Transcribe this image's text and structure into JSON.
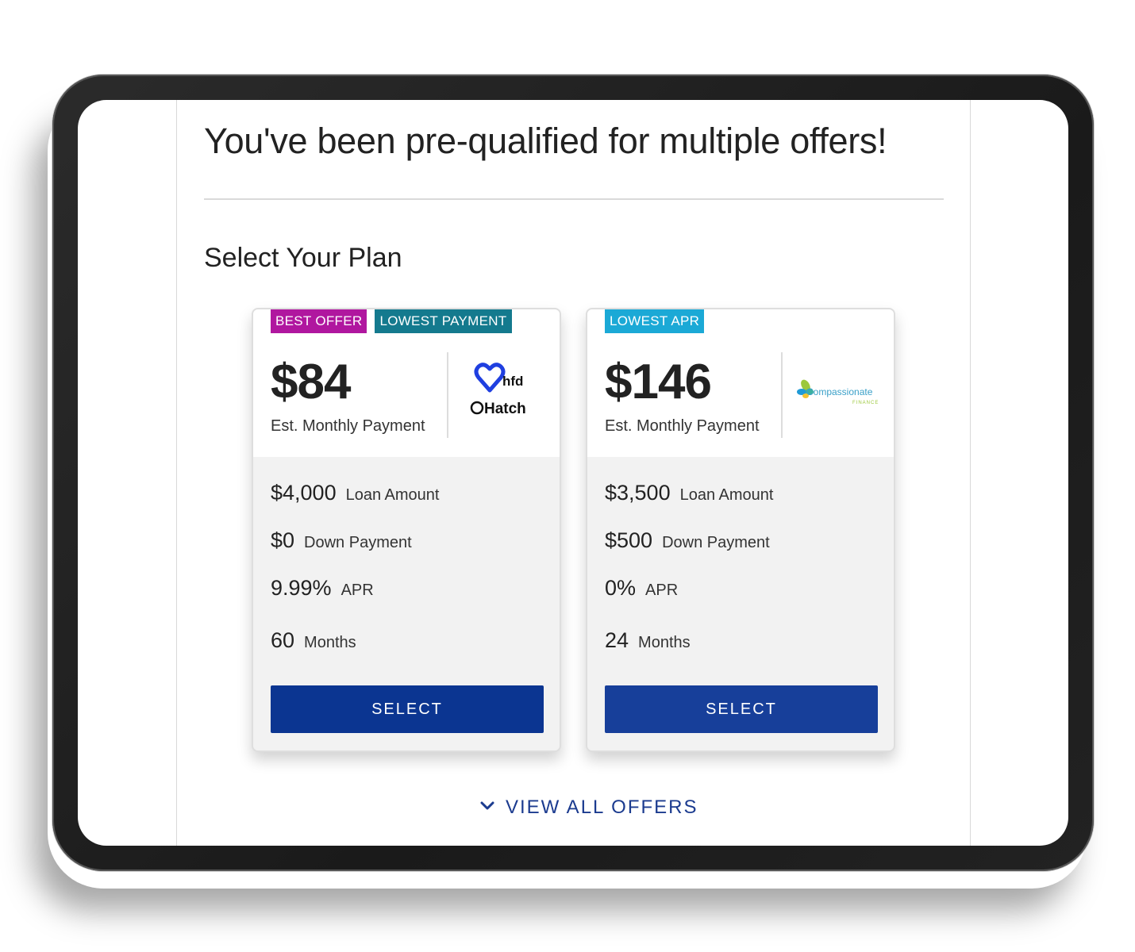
{
  "page": {
    "headline": "You've been pre-qualified for multiple offers!",
    "section_title": "Select Your Plan"
  },
  "offers": [
    {
      "tags": [
        {
          "label": "BEST OFFER",
          "color": "#b0179f"
        },
        {
          "label": "LOWEST PAYMENT",
          "color": "#147a8e"
        }
      ],
      "monthly_payment": "$84",
      "monthly_label": "Est. Monthly Payment",
      "lender_logo": {
        "icon": "hfd-hatch-logo",
        "text_primary": "hfd",
        "text_secondary": "Hatch"
      },
      "loan_amount": "$4,000",
      "loan_amount_label": "Loan Amount",
      "down_payment": "$0",
      "down_payment_label": "Down Payment",
      "apr": "9.99%",
      "apr_label": "APR",
      "term": "60",
      "term_label": "Months",
      "select_label": "SELECT"
    },
    {
      "tags": [
        {
          "label": "LOWEST APR",
          "color": "#1ba9d6"
        }
      ],
      "monthly_payment": "$146",
      "monthly_label": "Est. Monthly Payment",
      "lender_logo": {
        "icon": "compassionate-finance-logo",
        "text_primary": "Compassionate",
        "text_secondary": "FINANCE"
      },
      "loan_amount": "$3,500",
      "loan_amount_label": "Loan Amount",
      "down_payment": "$500",
      "down_payment_label": "Down Payment",
      "apr": "0%",
      "apr_label": "APR",
      "term": "24",
      "term_label": "Months",
      "select_label": "SELECT"
    }
  ],
  "view_all": {
    "label": "VIEW ALL OFFERS",
    "icon": "chevron-down-icon"
  },
  "colors": {
    "primary_button": "#0b3591",
    "link": "#1b3b8f"
  }
}
